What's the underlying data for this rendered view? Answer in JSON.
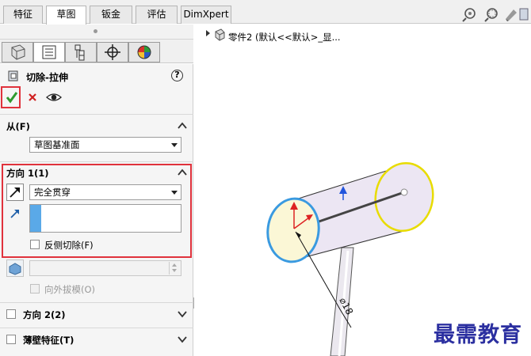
{
  "tabs": [
    "特征",
    "草图",
    "钣金",
    "评估",
    "DimXpert"
  ],
  "active_tab": "草图",
  "tree": {
    "root": "零件2 (默认<<默认>_显..."
  },
  "pm": {
    "title": "切除-拉伸",
    "help": "?",
    "from": {
      "label": "从(F)",
      "value": "草图基准面"
    },
    "dir1": {
      "label": "方向 1(1)",
      "end_condition": "完全贯穿",
      "flip_label": "反侧切除(F)"
    },
    "draft_label": "向外拔模(O)",
    "dir2_label": "方向 2(2)",
    "thin_label": "薄壁特征(T)"
  },
  "watermark": "最需教育",
  "dimension": "⌀18",
  "colors": {
    "highlight": "#e0323c",
    "ok": "#2f9a2f",
    "cancel": "#d02020",
    "cylinder": "#ece6f3",
    "sel_face": "#3a9ae0",
    "sel_edge": "#f0e000",
    "watermark": "#2b2fa0"
  }
}
